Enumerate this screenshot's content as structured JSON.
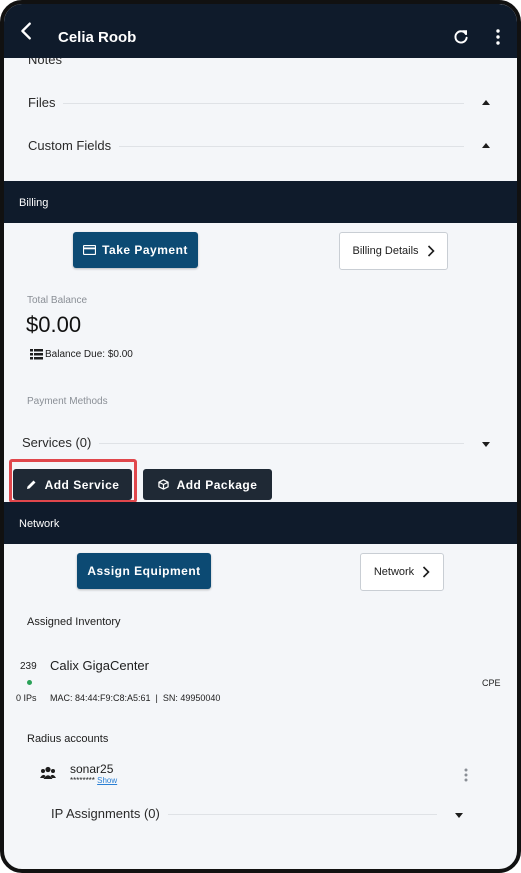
{
  "header": {
    "title": "Celia Roob"
  },
  "sections": {
    "notes_label": "Notes",
    "files_label": "Files",
    "custom_fields_label": "Custom Fields"
  },
  "billing": {
    "section_title": "Billing",
    "take_payment_label": "Take Payment",
    "billing_details_label": "Billing Details",
    "total_balance_label": "Total Balance",
    "total_balance_value": "$0.00",
    "balance_due": "Balance Due: $0.00",
    "payment_methods_label": "Payment Methods",
    "services_label": "Services (0)",
    "add_service_label": "Add Service",
    "add_package_label": "Add Package"
  },
  "network": {
    "section_title": "Network",
    "assign_equipment_label": "Assign Equipment",
    "network_label": "Network",
    "assigned_inventory_label": "Assigned Inventory",
    "item": {
      "id": "239",
      "name": "Calix GigaCenter",
      "ips": "0 IPs",
      "mac_sn": "MAC: 84:44:F9:C8:A5:61  |  SN: 49950040",
      "type": "CPE",
      "status_color": "#2aa158"
    },
    "radius_label": "Radius accounts",
    "radius": {
      "username": "sonar25",
      "password_mask": "********",
      "show_label": "Show"
    },
    "ip_assignments_label": "IP Assignments (0)"
  },
  "colors": {
    "dark_bar": "#0f1b2b",
    "primary_button": "#0c4a73",
    "highlight": "#e0474c"
  }
}
